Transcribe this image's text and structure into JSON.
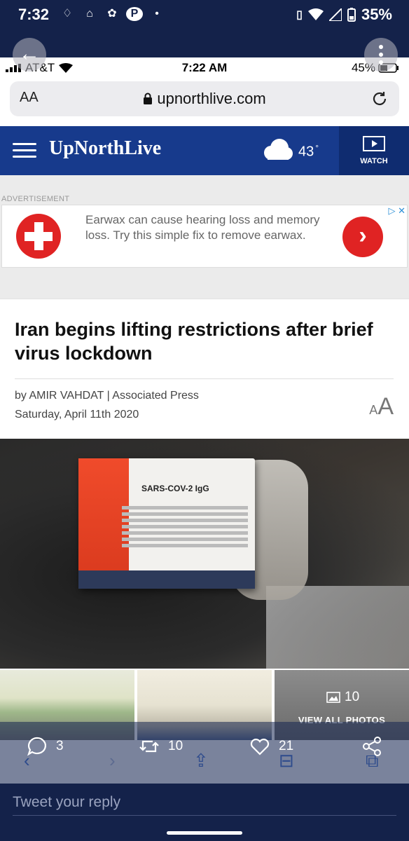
{
  "android_status": {
    "time": "7:32",
    "battery": "35%",
    "notification_dot": "•"
  },
  "ios_status": {
    "carrier": "AT&T",
    "time": "7:22 AM",
    "battery": "45%"
  },
  "browser": {
    "text_size_label": "AA",
    "url": "upnorthlive.com"
  },
  "site_header": {
    "logo": "UpNorthLive",
    "temperature": "43",
    "degree": "°",
    "watch_label": "WATCH"
  },
  "ad": {
    "label": "ADVERTISEMENT",
    "text": "Earwax can cause hearing loss and memory loss. Try this simple fix to remove earwax.",
    "choices": "▷ ✕"
  },
  "article": {
    "headline": "Iran begins lifting restrictions after brief virus lockdown",
    "byline": "by AMIR VAHDAT | Associated Press",
    "date": "Saturday, April 11th 2020",
    "text_size_small": "A",
    "text_size_large": "A"
  },
  "hero_photo": {
    "kit_title": "SARS-COV-2 IgG"
  },
  "gallery": {
    "photo_count": "10",
    "view_all": "VIEW ALL PHOTOS"
  },
  "tweet": {
    "replies": "3",
    "retweets": "10",
    "likes": "21",
    "reply_placeholder": "Tweet your reply"
  },
  "colors": {
    "brand_blue": "#173a8c",
    "twitter_navy": "#14224a",
    "ad_red": "#e02323"
  }
}
